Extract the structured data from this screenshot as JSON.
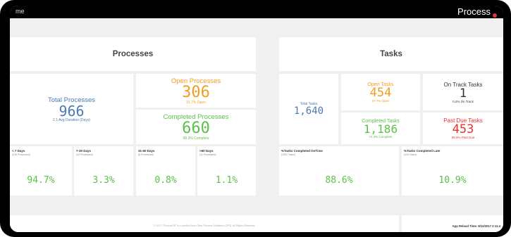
{
  "topbar": {
    "left_text": "me",
    "title": "Process"
  },
  "processes": {
    "header": "Processes",
    "total": {
      "label": "Total Processes",
      "value": "966",
      "sub": "2.1 Avg Duration (Days)"
    },
    "open": {
      "label": "Open Processes",
      "value": "306",
      "sub": "31.7% Open"
    },
    "completed": {
      "label": "Completed Processes",
      "value": "660",
      "sub": "68.3% Complete"
    },
    "buckets": [
      {
        "label": "< 7 Days",
        "sub": "(915 Processed)",
        "value": "94.7%"
      },
      {
        "label": "7-30 Days",
        "sub": "(32 Processed)",
        "value": "3.3%"
      },
      {
        "label": "31-60 Days",
        "sub": "(8 Processed)",
        "value": "0.8%"
      },
      {
        "label": ">60 Days",
        "sub": "(11 Processed)",
        "value": "1.1%"
      }
    ]
  },
  "tasks": {
    "header": "Tasks",
    "total": {
      "label": "Total Tasks",
      "value": "1,640"
    },
    "open": {
      "label": "Open Tasks",
      "value": "454",
      "sub": "27.7% Open"
    },
    "on_track": {
      "label": "On Track Tasks",
      "value": "1",
      "sub": "0.2% On Track"
    },
    "completed": {
      "label": "Completed Tasks",
      "value": "1,186",
      "sub": "72.3% Complete"
    },
    "past_due": {
      "label": "Past Due Tasks",
      "value": "453",
      "sub": "99.8% Past Due"
    },
    "ontime": {
      "label": "%Tasks Completed OnTime",
      "sub": "(1051 Tasks)",
      "value": "88.6%"
    },
    "late": {
      "label": "%Tasks Completed Late",
      "sub": "(129 Tasks)",
      "value": "10.9%"
    }
  },
  "footer": {
    "copyright": "© 2017 \"Process BI\" is a product from Clear Process Solutions (CPS). All Rights Reserved.",
    "reload": "App Reload Time: 8/12/2017 2:11:4"
  },
  "colors": {
    "blue": "#4a7bb5",
    "orange": "#f39c1f",
    "green": "#5cc04a",
    "red": "#e8312d"
  }
}
